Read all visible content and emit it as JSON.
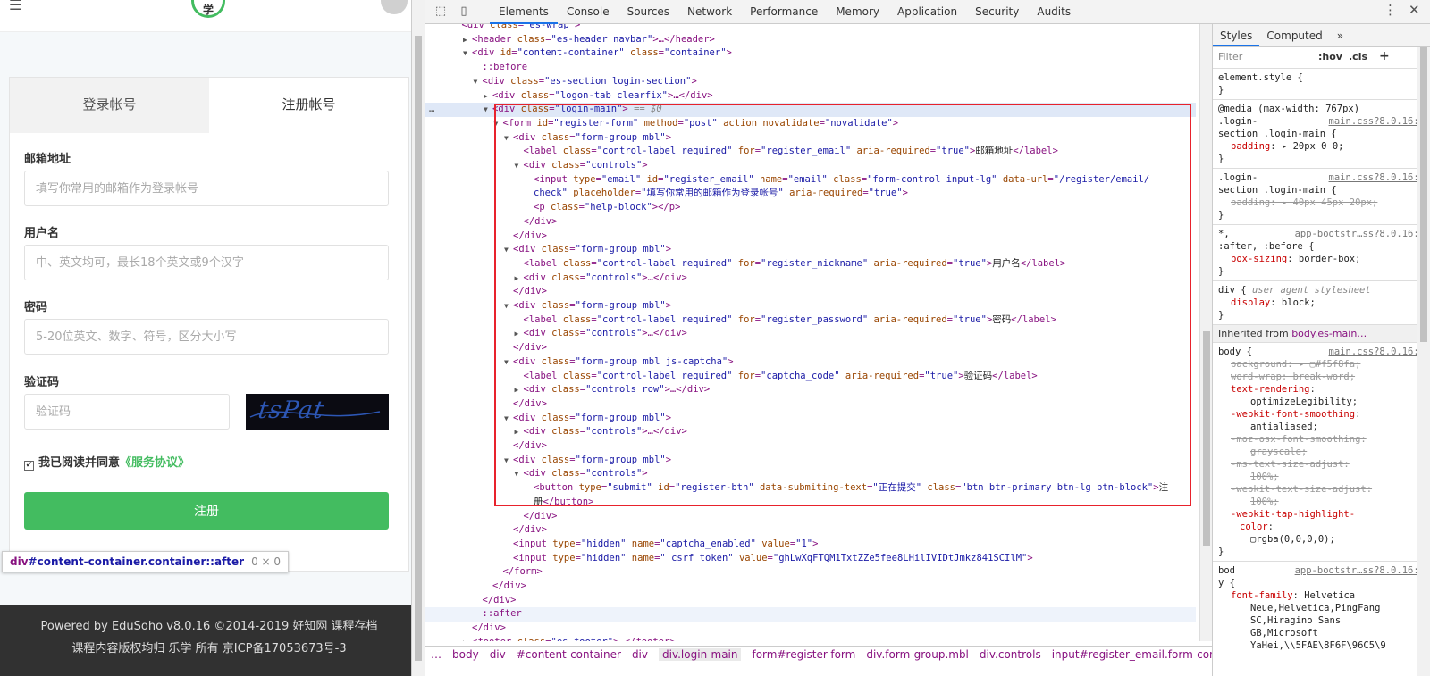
{
  "page": {
    "hamburger_icon": "menu-icon",
    "logo_text": "学",
    "tabs": [
      "登录帐号",
      "注册帐号"
    ],
    "active_tab": 1,
    "fields": [
      {
        "label": "邮箱地址",
        "placeholder": "填写你常用的邮箱作为登录帐号"
      },
      {
        "label": "用户名",
        "placeholder": "中、英文均可，最长18个英文或9个汉字"
      },
      {
        "label": "密码",
        "placeholder": "5-20位英文、数字、符号，区分大小写"
      },
      {
        "label": "验证码",
        "placeholder": "验证码"
      }
    ],
    "captcha_text": "tsPat",
    "agree_text": "我已阅读并同意",
    "agree_link": "《服务协议》",
    "submit_label": "注册",
    "tooltip_selector_tag": "div",
    "tooltip_selector": "#content-container.container::after",
    "tooltip_dims": "0 × 0",
    "footer_line1": "Powered by EduSoho v8.0.16 ©2014-2019    好知网    课程存档",
    "footer_line2": "课程内容版权均归 乐学 所有    京ICP备17053673号-3",
    "brand_color": "#43bc60"
  },
  "devtools": {
    "tabs": [
      "Elements",
      "Console",
      "Sources",
      "Network",
      "Performance",
      "Memory",
      "Application",
      "Security",
      "Audits"
    ],
    "active_tab": "Elements",
    "dom_lines": [
      {
        "indent": 3,
        "tri": "",
        "html": "<span class='tg'>&lt;div</span> <span class='an'>class</span>=<span class='av'>\"es-wrap\"</span><span class='tg'>&gt;</span>"
      },
      {
        "indent": 4,
        "tri": "▶",
        "html": "<span class='tg'>&lt;header</span> <span class='an'>class</span>=<span class='av'>\"es-header navbar\"</span><span class='tg'>&gt;</span>…<span class='tg'>&lt;/header&gt;</span>"
      },
      {
        "indent": 4,
        "tri": "▼",
        "html": "<span class='tg'>&lt;div</span> <span class='an'>id</span>=<span class='av'>\"content-container\"</span> <span class='an'>class</span>=<span class='av'>\"container\"</span><span class='tg'>&gt;</span>"
      },
      {
        "indent": 5,
        "tri": "",
        "html": "<span class='ps'>::before</span>"
      },
      {
        "indent": 5,
        "tri": "▼",
        "html": "<span class='tg'>&lt;div</span> <span class='an'>class</span>=<span class='av'>\"es-section login-section\"</span><span class='tg'>&gt;</span>"
      },
      {
        "indent": 6,
        "tri": "▶",
        "html": "<span class='tg'>&lt;div</span> <span class='an'>class</span>=<span class='av'>\"logon-tab clearfix\"</span><span class='tg'>&gt;</span>…<span class='tg'>&lt;/div&gt;</span>"
      },
      {
        "indent": 6,
        "tri": "▼",
        "sel": true,
        "html": "<span class='tg'>&lt;div</span> <span class='an'>class</span>=<span class='av'>\"login-main\"</span><span class='tg'>&gt;</span> <span class='dm'>== $0</span>"
      },
      {
        "indent": 7,
        "tri": "▼",
        "html": "<span class='tg'>&lt;form</span> <span class='an'>id</span>=<span class='av'>\"register-form\"</span> <span class='an'>method</span>=<span class='av'>\"post\"</span> <span class='an'>action novalidate</span>=<span class='av'>\"novalidate\"</span><span class='tg'>&gt;</span>"
      },
      {
        "indent": 8,
        "tri": "▼",
        "html": "<span class='tg'>&lt;div</span> <span class='an'>class</span>=<span class='av'>\"form-group mbl\"</span><span class='tg'>&gt;</span>"
      },
      {
        "indent": 9,
        "tri": "",
        "html": "<span class='tg'>&lt;label</span> <span class='an'>class</span>=<span class='av'>\"control-label required\"</span> <span class='an'>for</span>=<span class='av'>\"register_email\"</span> <span class='an'>aria-required</span>=<span class='av'>\"true\"</span><span class='tg'>&gt;</span><span class='tx'>邮箱地址</span><span class='tg'>&lt;/label&gt;</span>"
      },
      {
        "indent": 9,
        "tri": "▼",
        "html": "<span class='tg'>&lt;div</span> <span class='an'>class</span>=<span class='av'>\"controls\"</span><span class='tg'>&gt;</span>"
      },
      {
        "indent": 10,
        "tri": "",
        "html": "<span class='tg'>&lt;input</span> <span class='an'>type</span>=<span class='av'>\"email\"</span> <span class='an'>id</span>=<span class='av'>\"register_email\"</span> <span class='an'>name</span>=<span class='av'>\"email\"</span> <span class='an'>class</span>=<span class='av'>\"form-control input-lg\"</span> <span class='an'>data-url</span>=<span class='av'>\"/register/email/</span>"
      },
      {
        "indent": 10,
        "tri": "",
        "html": "<span class='av'>check\"</span> <span class='an'>placeholder</span>=<span class='av'>\"填写你常用的邮箱作为登录帐号\"</span> <span class='an'>aria-required</span>=<span class='av'>\"true\"</span><span class='tg'>&gt;</span>"
      },
      {
        "indent": 10,
        "tri": "",
        "html": "<span class='tg'>&lt;p</span> <span class='an'>class</span>=<span class='av'>\"help-block\"</span><span class='tg'>&gt;&lt;/p&gt;</span>"
      },
      {
        "indent": 9,
        "tri": "",
        "html": "<span class='tg'>&lt;/div&gt;</span>"
      },
      {
        "indent": 8,
        "tri": "",
        "html": "<span class='tg'>&lt;/div&gt;</span>"
      },
      {
        "indent": 8,
        "tri": "▼",
        "html": "<span class='tg'>&lt;div</span> <span class='an'>class</span>=<span class='av'>\"form-group mbl\"</span><span class='tg'>&gt;</span>"
      },
      {
        "indent": 9,
        "tri": "",
        "html": "<span class='tg'>&lt;label</span> <span class='an'>class</span>=<span class='av'>\"control-label required\"</span> <span class='an'>for</span>=<span class='av'>\"register_nickname\"</span> <span class='an'>aria-required</span>=<span class='av'>\"true\"</span><span class='tg'>&gt;</span><span class='tx'>用户名</span><span class='tg'>&lt;/label&gt;</span>"
      },
      {
        "indent": 9,
        "tri": "▶",
        "html": "<span class='tg'>&lt;div</span> <span class='an'>class</span>=<span class='av'>\"controls\"</span><span class='tg'>&gt;</span>…<span class='tg'>&lt;/div&gt;</span>"
      },
      {
        "indent": 8,
        "tri": "",
        "html": "<span class='tg'>&lt;/div&gt;</span>"
      },
      {
        "indent": 8,
        "tri": "▼",
        "html": "<span class='tg'>&lt;div</span> <span class='an'>class</span>=<span class='av'>\"form-group mbl\"</span><span class='tg'>&gt;</span>"
      },
      {
        "indent": 9,
        "tri": "",
        "html": "<span class='tg'>&lt;label</span> <span class='an'>class</span>=<span class='av'>\"control-label required\"</span> <span class='an'>for</span>=<span class='av'>\"register_password\"</span> <span class='an'>aria-required</span>=<span class='av'>\"true\"</span><span class='tg'>&gt;</span><span class='tx'>密码</span><span class='tg'>&lt;/label&gt;</span>"
      },
      {
        "indent": 9,
        "tri": "▶",
        "html": "<span class='tg'>&lt;div</span> <span class='an'>class</span>=<span class='av'>\"controls\"</span><span class='tg'>&gt;</span>…<span class='tg'>&lt;/div&gt;</span>"
      },
      {
        "indent": 8,
        "tri": "",
        "html": "<span class='tg'>&lt;/div&gt;</span>"
      },
      {
        "indent": 8,
        "tri": "▼",
        "html": "<span class='tg'>&lt;div</span> <span class='an'>class</span>=<span class='av'>\"form-group mbl js-captcha\"</span><span class='tg'>&gt;</span>"
      },
      {
        "indent": 9,
        "tri": "",
        "html": "<span class='tg'>&lt;label</span> <span class='an'>class</span>=<span class='av'>\"control-label required\"</span> <span class='an'>for</span>=<span class='av'>\"captcha_code\"</span> <span class='an'>aria-required</span>=<span class='av'>\"true\"</span><span class='tg'>&gt;</span><span class='tx'>验证码</span><span class='tg'>&lt;/label&gt;</span>"
      },
      {
        "indent": 9,
        "tri": "▶",
        "html": "<span class='tg'>&lt;div</span> <span class='an'>class</span>=<span class='av'>\"controls row\"</span><span class='tg'>&gt;</span>…<span class='tg'>&lt;/div&gt;</span>"
      },
      {
        "indent": 8,
        "tri": "",
        "html": "<span class='tg'>&lt;/div&gt;</span>"
      },
      {
        "indent": 8,
        "tri": "▼",
        "html": "<span class='tg'>&lt;div</span> <span class='an'>class</span>=<span class='av'>\"form-group mbl\"</span><span class='tg'>&gt;</span>"
      },
      {
        "indent": 9,
        "tri": "▶",
        "html": "<span class='tg'>&lt;div</span> <span class='an'>class</span>=<span class='av'>\"controls\"</span><span class='tg'>&gt;</span>…<span class='tg'>&lt;/div&gt;</span>"
      },
      {
        "indent": 8,
        "tri": "",
        "html": "<span class='tg'>&lt;/div&gt;</span>"
      },
      {
        "indent": 8,
        "tri": "▼",
        "html": "<span class='tg'>&lt;div</span> <span class='an'>class</span>=<span class='av'>\"form-group mbl\"</span><span class='tg'>&gt;</span>"
      },
      {
        "indent": 9,
        "tri": "▼",
        "html": "<span class='tg'>&lt;div</span> <span class='an'>class</span>=<span class='av'>\"controls\"</span><span class='tg'>&gt;</span>"
      },
      {
        "indent": 10,
        "tri": "",
        "html": "<span class='tg'>&lt;button</span> <span class='an'>type</span>=<span class='av'>\"submit\"</span> <span class='an'>id</span>=<span class='av'>\"register-btn\"</span> <span class='an'>data-submiting-text</span>=<span class='av'>\"正在提交\"</span> <span class='an'>class</span>=<span class='av'>\"btn btn-primary btn-lg btn-block\"</span><span class='tg'>&gt;</span><span class='tx'>注</span>"
      },
      {
        "indent": 10,
        "tri": "",
        "html": "<span class='tx'>册</span><span class='tg'>&lt;/button&gt;</span>"
      },
      {
        "indent": 9,
        "tri": "",
        "html": "<span class='tg'>&lt;/div&gt;</span>"
      },
      {
        "indent": 8,
        "tri": "",
        "html": "<span class='tg'>&lt;/div&gt;</span>"
      },
      {
        "indent": 8,
        "tri": "",
        "html": "<span class='tg'>&lt;input</span> <span class='an'>type</span>=<span class='av'>\"hidden\"</span> <span class='an'>name</span>=<span class='av'>\"captcha_enabled\"</span> <span class='an'>value</span>=<span class='av'>\"1\"</span><span class='tg'>&gt;</span>"
      },
      {
        "indent": 8,
        "tri": "",
        "html": "<span class='tg'>&lt;input</span> <span class='an'>type</span>=<span class='av'>\"hidden\"</span> <span class='an'>name</span>=<span class='av'>\"_csrf_token\"</span> <span class='an'>value</span>=<span class='av'>\"ghLwXqFTQM1TxtZZe5fee8LHilIVIDtJmkz841SCIlM\"</span><span class='tg'>&gt;</span>"
      },
      {
        "indent": 7,
        "tri": "",
        "html": "<span class='tg'>&lt;/form&gt;</span>"
      },
      {
        "indent": 6,
        "tri": "",
        "html": "<span class='tg'>&lt;/div&gt;</span>"
      },
      {
        "indent": 5,
        "tri": "",
        "html": "<span class='tg'>&lt;/div&gt;</span>"
      },
      {
        "indent": 5,
        "tri": "",
        "sel2": true,
        "html": "<span class='ps'>::after</span>"
      },
      {
        "indent": 4,
        "tri": "",
        "html": "<span class='tg'>&lt;/div&gt;</span>"
      },
      {
        "indent": 4,
        "tri": "▶",
        "html": "<span class='tg'>&lt;footer</span> <span class='an'>class</span>=<span class='av'>\"es-footer\"</span><span class='tg'>&gt;</span>…<span class='tg'>&lt;/footer&gt;</span>"
      }
    ],
    "breadcrumb": [
      "…",
      "body",
      "div",
      "#content-container",
      "div",
      "div.login-main",
      "form#register-form",
      "div.form-group.mbl",
      "div.controls",
      "input#register_email.form-control.input-lg"
    ],
    "breadcrumb_current": 5,
    "styles_tabs": [
      "Styles",
      "Computed",
      "»"
    ],
    "filter_placeholder": "Filter",
    "filter_hov": ":hov",
    "filter_cls": ".cls",
    "filter_add": "+",
    "inherited_label": "Inherited from",
    "inherited_link": "body.es-main…"
  }
}
